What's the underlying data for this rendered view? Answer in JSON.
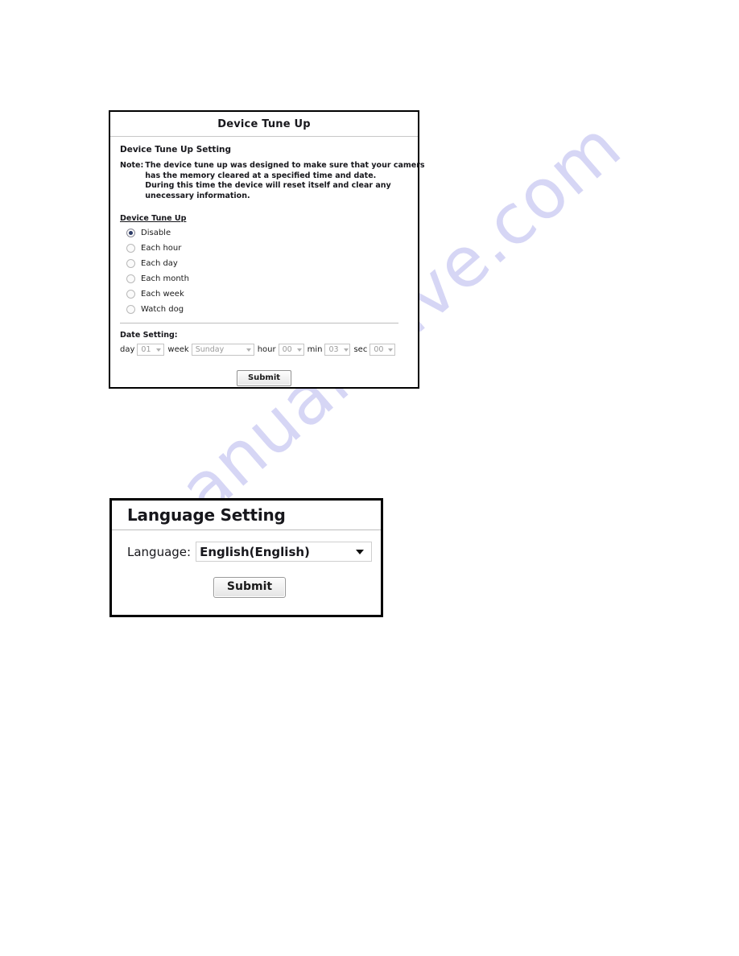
{
  "watermark": {
    "text": "manualshive.com"
  },
  "device_tune_up_panel": {
    "title": "Device Tune Up",
    "section_heading": "Device Tune Up Setting",
    "note": {
      "label": "Note:",
      "lines": [
        "The device tune up was designed to make sure that your camers",
        "has the memory cleared at a specified time and date.",
        "During this time the device will reset itself and clear any",
        "unecessary information."
      ]
    },
    "group_label": "Device Tune Up",
    "options": [
      {
        "label": "Disable",
        "selected": true
      },
      {
        "label": "Each hour",
        "selected": false
      },
      {
        "label": "Each day",
        "selected": false
      },
      {
        "label": "Each month",
        "selected": false
      },
      {
        "label": "Each week",
        "selected": false
      },
      {
        "label": "Watch dog",
        "selected": false
      }
    ],
    "date_setting": {
      "heading": "Date Setting:",
      "day_label": "day",
      "day_value": "01",
      "week_label": "week",
      "week_value": "Sunday",
      "hour_label": "hour",
      "hour_value": "00",
      "min_label": "min",
      "min_value": "03",
      "sec_label": "sec",
      "sec_value": "00"
    },
    "submit_label": "Submit"
  },
  "language_panel": {
    "title": "Language Setting",
    "language_label": "Language:",
    "language_value": "English(English)",
    "submit_label": "Submit"
  }
}
